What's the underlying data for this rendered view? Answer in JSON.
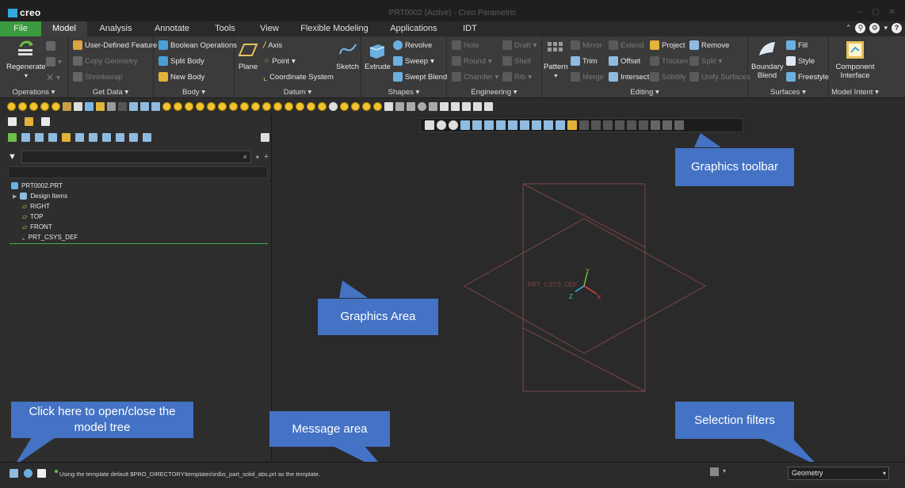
{
  "titlebar": {
    "logo": "creo",
    "title": "PRT0002 (Active) - Creo Parametric",
    "min": "–",
    "max": "▢",
    "close": "✕"
  },
  "tabs": [
    {
      "label": "File"
    },
    {
      "label": "Model"
    },
    {
      "label": "Analysis"
    },
    {
      "label": "Annotate"
    },
    {
      "label": "Tools"
    },
    {
      "label": "View"
    },
    {
      "label": "Flexible Modeling"
    },
    {
      "label": "Applications"
    },
    {
      "label": "IDT"
    }
  ],
  "ribbon": {
    "operations": {
      "label": "Operations",
      "regenerate": "Regenerate"
    },
    "get_data": {
      "label": "Get Data",
      "user_defined_feature": "User-Defined Feature",
      "copy_geometry": "Copy Geometry",
      "shrinkwrap": "Shrinkwrap"
    },
    "body": {
      "label": "Body",
      "boolean_operations": "Boolean Operations",
      "split_body": "Split Body",
      "new_body": "New Body"
    },
    "datum": {
      "label": "Datum",
      "plane": "Plane",
      "axis": "Axis",
      "point": "Point",
      "coordinate_system": "Coordinate System",
      "sketch": "Sketch"
    },
    "shapes": {
      "label": "Shapes",
      "extrude": "Extrude",
      "revolve": "Revolve",
      "sweep": "Sweep",
      "swept_blend": "Swept Blend"
    },
    "engineering": {
      "label": "Engineering",
      "hole": "Hole",
      "draft": "Draft",
      "round": "Round",
      "shell": "Shell",
      "chamfer": "Chamfer",
      "rib": "Rib"
    },
    "editing": {
      "label": "Editing",
      "pattern": "Pattern",
      "mirror": "Mirror",
      "extend": "Extend",
      "project": "Project",
      "remove": "Remove",
      "trim": "Trim",
      "offset": "Offset",
      "thicken": "Thicken",
      "split": "Split",
      "merge": "Merge",
      "intersect": "Intersect",
      "solidify": "Solidify",
      "unify_surfaces": "Unify Surfaces"
    },
    "surfaces": {
      "label": "Surfaces",
      "boundary_blend": "Boundary Blend",
      "fill": "Fill",
      "style": "Style",
      "freestyle": "Freestyle"
    },
    "model_intent": {
      "label": "Model Intent",
      "component_interface": "Component Interface"
    }
  },
  "model_tree": {
    "filter_clear": "×",
    "items": [
      {
        "label": "PRT0002.PRT"
      },
      {
        "label": "Design Items"
      },
      {
        "label": "RIGHT"
      },
      {
        "label": "TOP"
      },
      {
        "label": "FRONT"
      },
      {
        "label": "PRT_CSYS_DEF"
      }
    ]
  },
  "graphics": {
    "csys_label": "PRT_CSYS_DEF",
    "axis_x": "X",
    "axis_y": "Y",
    "axis_z": "Z"
  },
  "callouts": {
    "graphics_toolbar": "Graphics toolbar",
    "graphics_area": "Graphics Area",
    "model_tree_toggle": "Click here to open/close the model tree",
    "message_area": "Message area",
    "selection_filters": "Selection filters"
  },
  "status": {
    "message": "Using the template default $PRO_DIRECTORY\\templates\\inlbs_part_solid_abs.prt as the template.",
    "selection_filter": "Geometry"
  },
  "colors": {
    "file_tab": "#3c9a3f",
    "callout": "#4472c4",
    "datum_plane": "#8a4a4a",
    "tree_line": "#3cb043"
  }
}
